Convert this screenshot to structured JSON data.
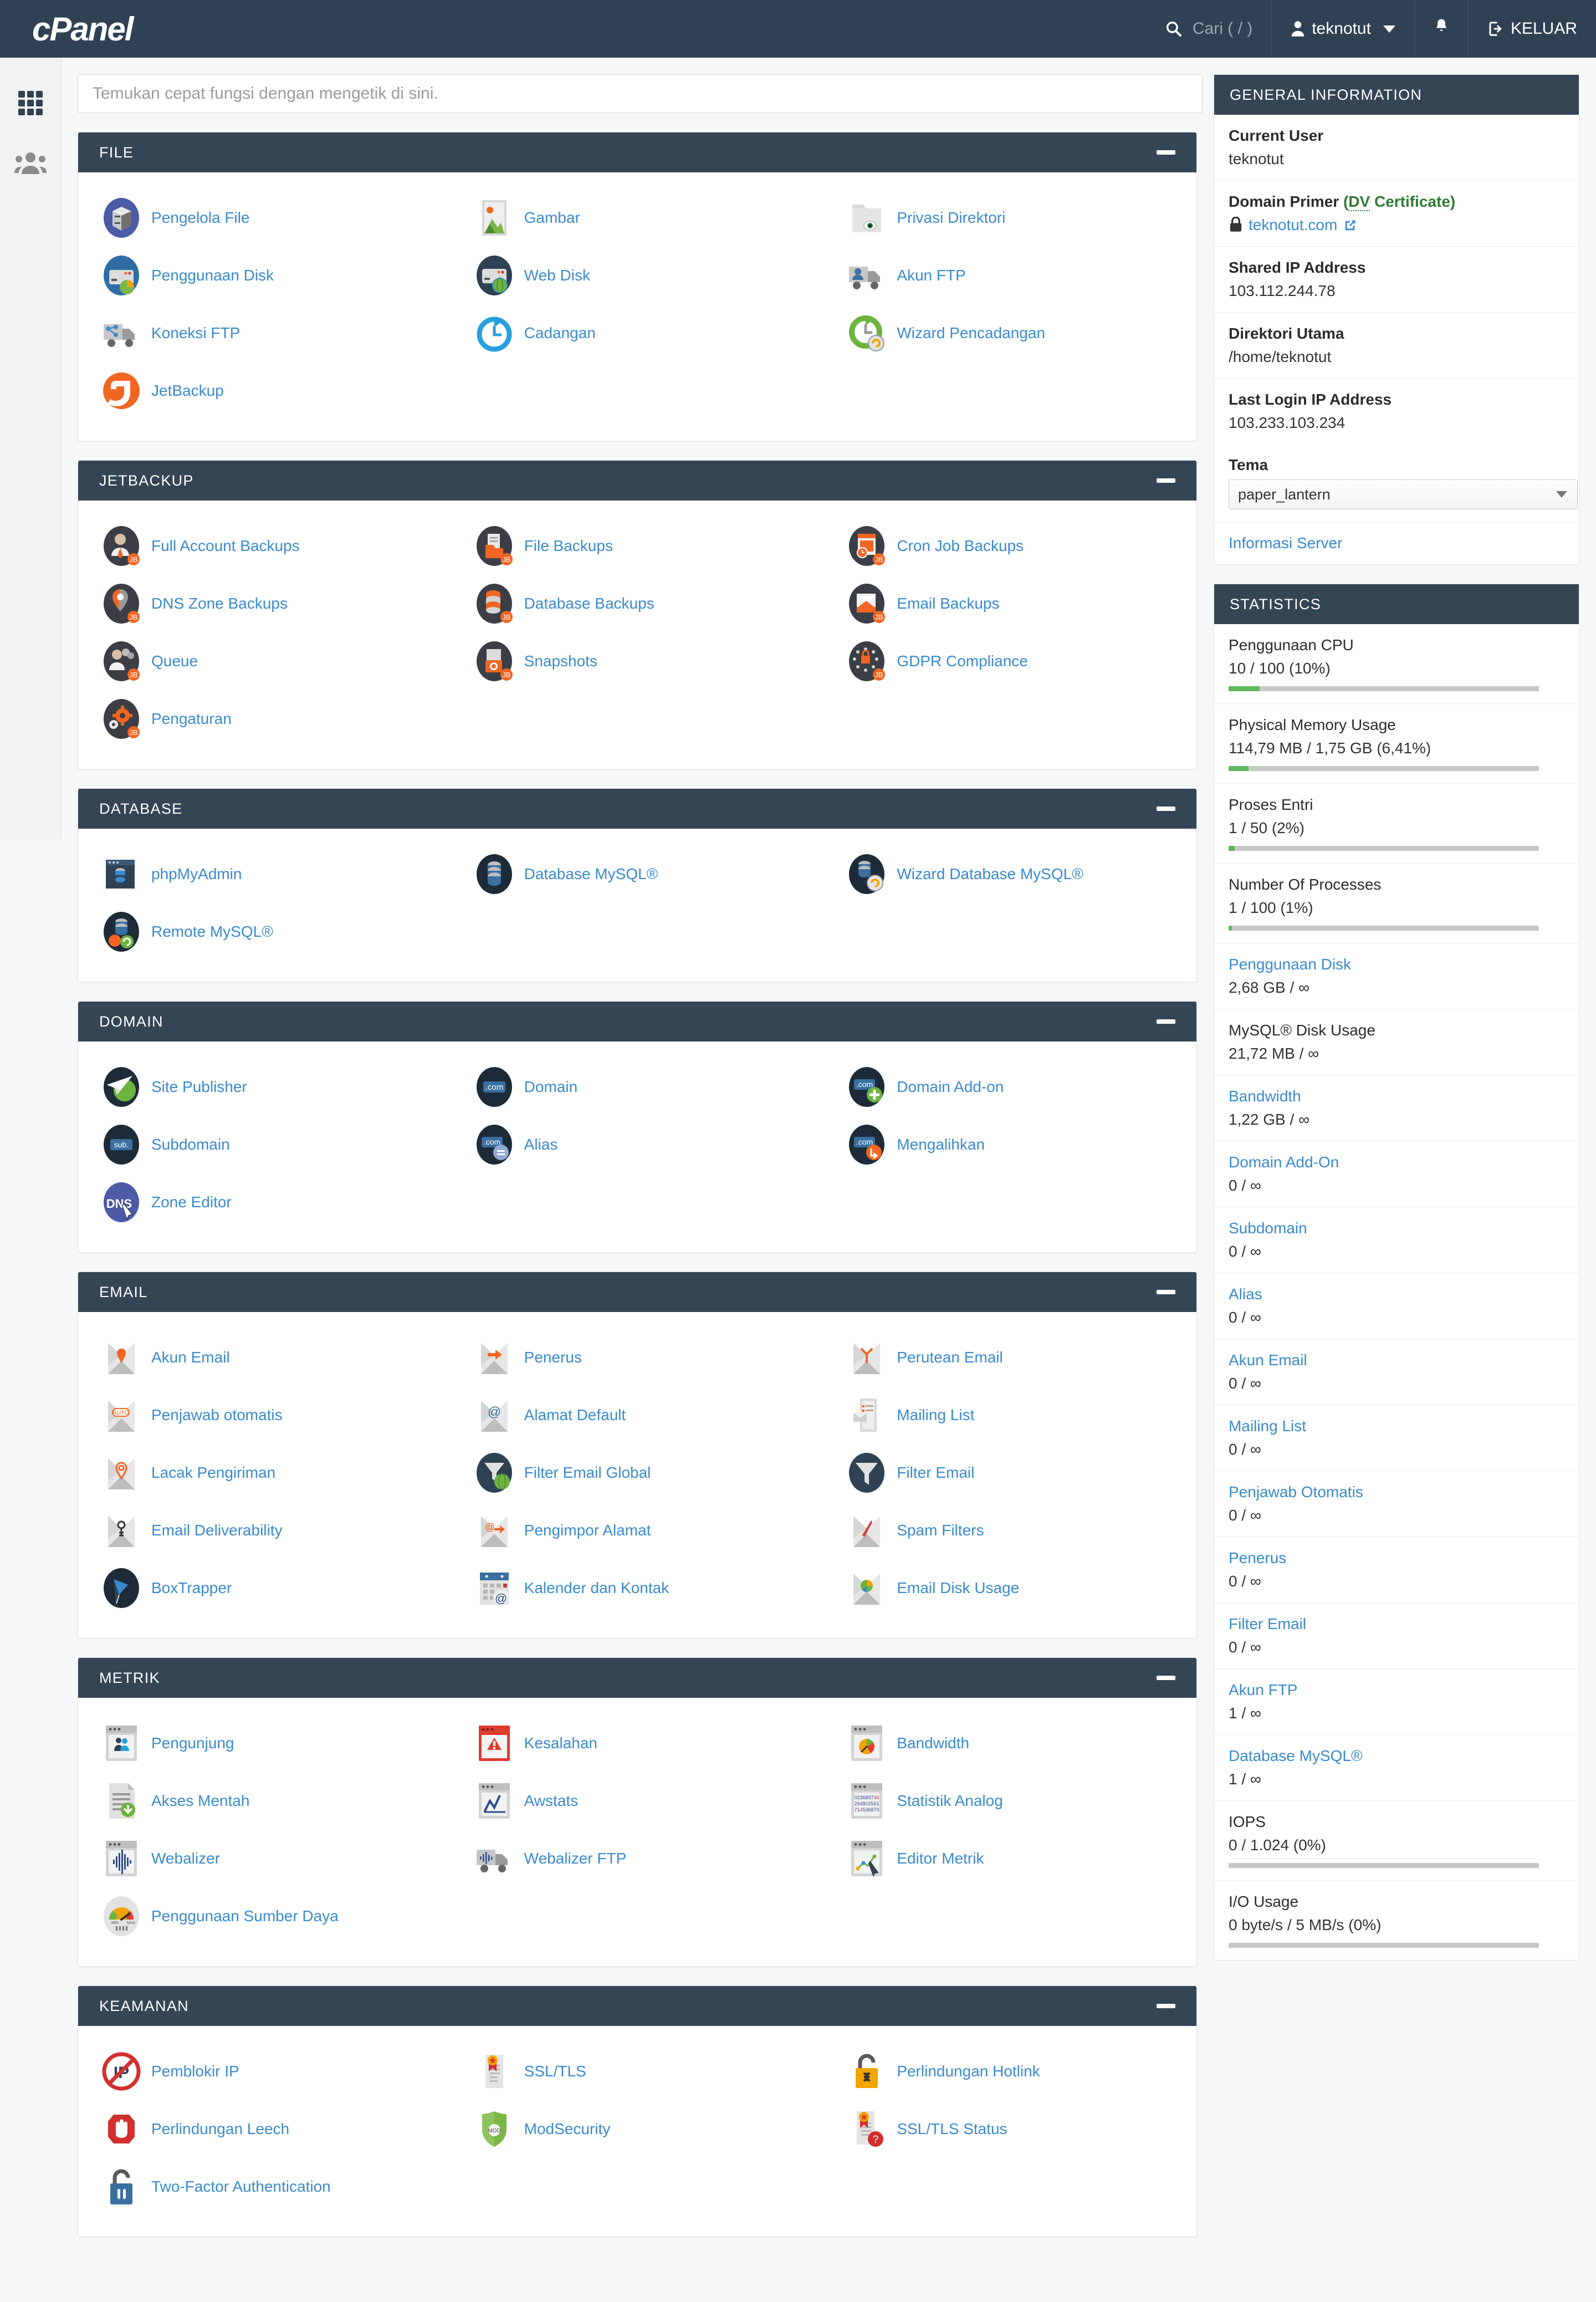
{
  "header": {
    "logo_text": "cPanel",
    "search_placeholder": "Cari ( / )",
    "search_icon": "search-icon",
    "user_name": "teknotut",
    "user_icon": "user-icon",
    "notification_icon": "bell-icon",
    "logout_label": "KELUAR",
    "logout_icon": "logout-icon"
  },
  "leftnav": {
    "items": [
      {
        "icon": "grid-apps-icon",
        "name": "apps"
      },
      {
        "icon": "users-group-icon",
        "name": "user-manager"
      }
    ]
  },
  "search": {
    "placeholder": "Temukan cepat fungsi dengan mengetik di sini.",
    "value": ""
  },
  "sections": [
    {
      "title": "FILE",
      "collapse_label": "–",
      "tools": [
        {
          "label": "Pengelola File",
          "icon": "file-manager-icon"
        },
        {
          "label": "Gambar",
          "icon": "images-icon"
        },
        {
          "label": "Privasi Direktori",
          "icon": "directory-privacy-icon"
        },
        {
          "label": "Penggunaan Disk",
          "icon": "disk-usage-icon"
        },
        {
          "label": "Web Disk",
          "icon": "web-disk-icon"
        },
        {
          "label": "Akun FTP",
          "icon": "ftp-accounts-icon"
        },
        {
          "label": "Koneksi FTP",
          "icon": "ftp-connections-icon"
        },
        {
          "label": "Cadangan",
          "icon": "backup-icon"
        },
        {
          "label": "Wizard Pencadangan",
          "icon": "backup-wizard-icon"
        },
        {
          "label": "JetBackup",
          "icon": "jetbackup-icon"
        }
      ]
    },
    {
      "title": "JETBACKUP",
      "collapse_label": "–",
      "tools": [
        {
          "label": "Full Account Backups",
          "icon": "full-account-backups-icon"
        },
        {
          "label": "File Backups",
          "icon": "file-backups-icon"
        },
        {
          "label": "Cron Job Backups",
          "icon": "cron-job-backups-icon"
        },
        {
          "label": "DNS Zone Backups",
          "icon": "dns-zone-backups-icon"
        },
        {
          "label": "Database Backups",
          "icon": "database-backups-icon"
        },
        {
          "label": "Email Backups",
          "icon": "email-backups-icon"
        },
        {
          "label": "Queue",
          "icon": "queue-icon"
        },
        {
          "label": "Snapshots",
          "icon": "snapshots-icon"
        },
        {
          "label": "GDPR Compliance",
          "icon": "gdpr-compliance-icon"
        },
        {
          "label": "Pengaturan",
          "icon": "settings-gear-icon"
        }
      ]
    },
    {
      "title": "DATABASE",
      "collapse_label": "–",
      "tools": [
        {
          "label": "phpMyAdmin",
          "icon": "phpmyadmin-icon"
        },
        {
          "label": "Database MySQL®",
          "icon": "mysql-databases-icon"
        },
        {
          "label": "Wizard Database MySQL®",
          "icon": "mysql-wizard-icon"
        },
        {
          "label": "Remote MySQL®",
          "icon": "remote-mysql-icon"
        }
      ]
    },
    {
      "title": "DOMAIN",
      "collapse_label": "–",
      "tools": [
        {
          "label": "Site Publisher",
          "icon": "site-publisher-icon"
        },
        {
          "label": "Domain",
          "icon": "domains-icon"
        },
        {
          "label": "Domain Add-on",
          "icon": "addon-domains-icon"
        },
        {
          "label": "Subdomain",
          "icon": "subdomains-icon"
        },
        {
          "label": "Alias",
          "icon": "aliases-icon"
        },
        {
          "label": "Mengalihkan",
          "icon": "redirects-icon"
        },
        {
          "label": "Zone Editor",
          "icon": "zone-editor-icon"
        }
      ]
    },
    {
      "title": "EMAIL",
      "collapse_label": "–",
      "tools": [
        {
          "label": "Akun Email",
          "icon": "email-accounts-icon"
        },
        {
          "label": "Penerus",
          "icon": "forwarders-icon"
        },
        {
          "label": "Perutean Email",
          "icon": "email-routing-icon"
        },
        {
          "label": "Penjawab otomatis",
          "icon": "autoresponders-icon"
        },
        {
          "label": "Alamat Default",
          "icon": "default-address-icon"
        },
        {
          "label": "Mailing List",
          "icon": "mailing-lists-icon"
        },
        {
          "label": "Lacak Pengiriman",
          "icon": "track-delivery-icon"
        },
        {
          "label": "Filter Email Global",
          "icon": "global-email-filters-icon"
        },
        {
          "label": "Filter Email",
          "icon": "email-filters-icon"
        },
        {
          "label": "Email Deliverability",
          "icon": "email-deliverability-icon"
        },
        {
          "label": "Pengimpor Alamat",
          "icon": "address-importer-icon"
        },
        {
          "label": "Spam Filters",
          "icon": "spam-filters-icon"
        },
        {
          "label": "BoxTrapper",
          "icon": "boxtrapper-icon"
        },
        {
          "label": "Kalender dan Kontak",
          "icon": "calendars-contacts-icon"
        },
        {
          "label": "Email Disk Usage",
          "icon": "email-disk-usage-icon"
        }
      ]
    },
    {
      "title": "METRIK",
      "collapse_label": "–",
      "tools": [
        {
          "label": "Pengunjung",
          "icon": "visitors-icon"
        },
        {
          "label": "Kesalahan",
          "icon": "errors-icon"
        },
        {
          "label": "Bandwidth",
          "icon": "bandwidth-icon"
        },
        {
          "label": "Akses Mentah",
          "icon": "raw-access-icon"
        },
        {
          "label": "Awstats",
          "icon": "awstats-icon"
        },
        {
          "label": "Statistik Analog",
          "icon": "analog-stats-icon"
        },
        {
          "label": "Webalizer",
          "icon": "webalizer-icon"
        },
        {
          "label": "Webalizer FTP",
          "icon": "webalizer-ftp-icon"
        },
        {
          "label": "Editor Metrik",
          "icon": "metrics-editor-icon"
        },
        {
          "label": "Penggunaan Sumber Daya",
          "icon": "resource-usage-icon"
        }
      ]
    },
    {
      "title": "KEAMANAN",
      "collapse_label": "–",
      "tools": [
        {
          "label": "Pemblokir IP",
          "icon": "ip-blocker-icon"
        },
        {
          "label": "SSL/TLS",
          "icon": "ssl-tls-icon"
        },
        {
          "label": "Perlindungan Hotlink",
          "icon": "hotlink-protection-icon"
        },
        {
          "label": "Perlindungan Leech",
          "icon": "leech-protection-icon"
        },
        {
          "label": "ModSecurity",
          "icon": "modsecurity-icon"
        },
        {
          "label": "SSL/TLS Status",
          "icon": "ssl-tls-status-icon"
        },
        {
          "label": "Two-Factor Authentication",
          "icon": "two-factor-auth-icon"
        }
      ]
    }
  ],
  "general_information": {
    "title": "GENERAL INFORMATION",
    "rows": [
      {
        "label": "Current User",
        "value": "teknotut"
      },
      {
        "label": "Domain Primer",
        "extra": "(DV Certificate)",
        "value": "teknotut.com",
        "value_is_link": true,
        "lock_icon": "lock-icon",
        "external_icon": "external-link-icon"
      },
      {
        "label": "Shared IP Address",
        "value": "103.112.244.78"
      },
      {
        "label": "Direktori Utama",
        "value": "/home/teknotut"
      },
      {
        "label": "Last Login IP Address",
        "value": "103.233.103.234"
      }
    ],
    "theme_label": "Tema",
    "theme_value": "paper_lantern",
    "server_info_link": "Informasi Server"
  },
  "statistics": {
    "title": "STATISTICS",
    "rows": [
      {
        "label": "Penggunaan CPU",
        "value": "10 / 100   (10%)",
        "bar": 10,
        "is_link": false
      },
      {
        "label": "Physical Memory Usage",
        "value": "114,79 MB / 1,75 GB   (6,41%)",
        "bar": 6.41,
        "is_link": false
      },
      {
        "label": "Proses Entri",
        "value": "1 / 50   (2%)",
        "bar": 2,
        "is_link": false
      },
      {
        "label": "Number Of Processes",
        "value": "1 / 100   (1%)",
        "bar": 1,
        "is_link": false
      },
      {
        "label": "Penggunaan Disk",
        "value": "2,68 GB / ∞",
        "bar": null,
        "is_link": true
      },
      {
        "label": "MySQL® Disk Usage",
        "value": "21,72 MB / ∞",
        "bar": null,
        "is_link": false
      },
      {
        "label": "Bandwidth",
        "value": "1,22 GB / ∞",
        "bar": null,
        "is_link": true
      },
      {
        "label": "Domain Add-On",
        "value": "0 / ∞",
        "bar": null,
        "is_link": true
      },
      {
        "label": "Subdomain",
        "value": "0 / ∞",
        "bar": null,
        "is_link": true
      },
      {
        "label": "Alias",
        "value": "0 / ∞",
        "bar": null,
        "is_link": true
      },
      {
        "label": "Akun Email",
        "value": "0 / ∞",
        "bar": null,
        "is_link": true
      },
      {
        "label": "Mailing List",
        "value": "0 / ∞",
        "bar": null,
        "is_link": true
      },
      {
        "label": "Penjawab Otomatis",
        "value": "0 / ∞",
        "bar": null,
        "is_link": true
      },
      {
        "label": "Penerus",
        "value": "0 / ∞",
        "bar": null,
        "is_link": true
      },
      {
        "label": "Filter Email",
        "value": "0 / ∞",
        "bar": null,
        "is_link": true
      },
      {
        "label": "Akun FTP",
        "value": "1 / ∞",
        "bar": null,
        "is_link": true
      },
      {
        "label": "Database MySQL®",
        "value": "1 / ∞",
        "bar": null,
        "is_link": true
      },
      {
        "label": "IOPS",
        "value": "0 / 1.024   (0%)",
        "bar": 0,
        "is_link": false
      },
      {
        "label": "I/O Usage",
        "value": "0 byte/s / 5 MB/s   (0%)",
        "bar": 0,
        "is_link": false
      }
    ]
  },
  "colors": {
    "header_bg": "#2f4254",
    "panel_header_bg": "#344556",
    "link": "#3a8ace",
    "meter_fill": "#5cb85c",
    "cert_green": "#2f7a32"
  }
}
